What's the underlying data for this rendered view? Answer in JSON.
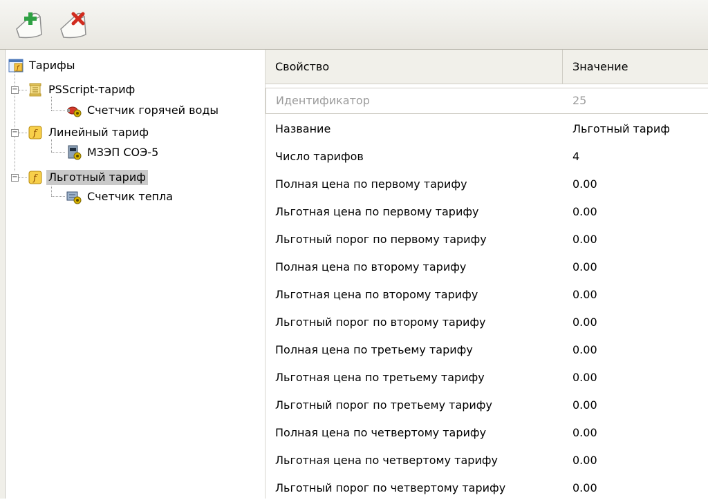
{
  "toolbar": {
    "buttons": [
      {
        "name": "add-tariff-button",
        "icon": "add-document-icon"
      },
      {
        "name": "delete-tariff-button",
        "icon": "delete-document-icon"
      }
    ]
  },
  "tree": {
    "root": {
      "label": "Тарифы",
      "icon": "tariffs-root-icon"
    },
    "items": [
      {
        "label": "PSScript-тариф",
        "icon": "script-tariff-icon",
        "children": [
          {
            "label": "Счетчик горячей воды",
            "icon": "hot-water-meter-icon"
          }
        ]
      },
      {
        "label": "Линейный тариф",
        "icon": "function-tariff-icon",
        "children": [
          {
            "label": "МЗЭП СОЭ-5",
            "icon": "electric-meter-icon"
          }
        ]
      },
      {
        "label": "Льготный тариф",
        "icon": "function-tariff-icon",
        "selected": true,
        "children": [
          {
            "label": "Счетчик тепла",
            "icon": "heat-meter-icon"
          }
        ]
      }
    ]
  },
  "grid": {
    "headers": {
      "property": "Свойство",
      "value": "Значение"
    },
    "rows": [
      {
        "property": "Идентификатор",
        "value": "25",
        "readonly": true
      },
      {
        "property": "Название",
        "value": "Льготный тариф"
      },
      {
        "property": "Число тарифов",
        "value": "4"
      },
      {
        "property": "Полная цена по первому тарифу",
        "value": "0.00"
      },
      {
        "property": "Льготная цена по первому тарифу",
        "value": "0.00"
      },
      {
        "property": "Льготный порог по первому тарифу",
        "value": "0.00"
      },
      {
        "property": "Полная цена по второму тарифу",
        "value": "0.00"
      },
      {
        "property": "Льготная цена по второму тарифу",
        "value": "0.00"
      },
      {
        "property": "Льготный порог по второму тарифу",
        "value": "0.00"
      },
      {
        "property": "Полная цена по третьему тарифу",
        "value": "0.00"
      },
      {
        "property": "Льготная цена по третьему тарифу",
        "value": "0.00"
      },
      {
        "property": "Льготный порог по третьему тарифу",
        "value": "0.00"
      },
      {
        "property": "Полная цена по четвертому тарифу",
        "value": "0.00"
      },
      {
        "property": "Льготная цена по четвертому тарифу",
        "value": "0.00"
      },
      {
        "property": "Льготный порог по четвертому тарифу",
        "value": "0.00"
      }
    ]
  },
  "colors": {
    "selection": "#c9c9c9",
    "readonly_text": "#9c9c9c",
    "add_accent": "#2ea043",
    "delete_accent": "#d12b1e"
  }
}
